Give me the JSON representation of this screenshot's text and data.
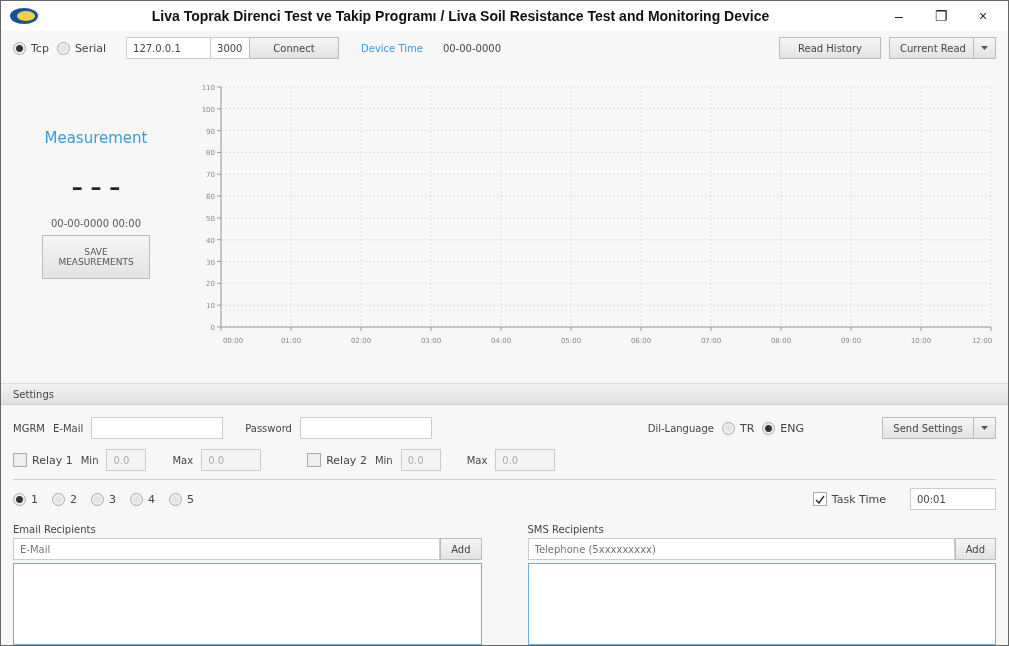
{
  "window": {
    "title": "Liva Toprak Direnci Test ve Takip Programı / Liva Soil Resistance Test and Monitoring Device",
    "controls": [
      "–",
      "❐",
      "×"
    ]
  },
  "connection": {
    "modes": [
      {
        "label": "Tcp",
        "selected": true
      },
      {
        "label": "Serial",
        "selected": false
      }
    ],
    "address": "127.0.0.1",
    "port": "3000",
    "connect": "Connect",
    "device_time_label": "Device Time",
    "device_time": "00-00-0000",
    "read_history": "Read History",
    "current_read": "Current Read"
  },
  "measurement": {
    "title": "Measurement",
    "value": "– – –",
    "timestamp": "00-00-0000 00:00",
    "save": "SAVE MEASUREMENTS"
  },
  "chart": {
    "chart_data": {
      "type": "line",
      "x": [
        "00:00",
        "01:00",
        "02:00",
        "03:00",
        "04:00",
        "05:00",
        "06:00",
        "07:00",
        "08:00",
        "09:00",
        "10:00",
        "12:00"
      ],
      "grid": true,
      "ylim": [
        0,
        110
      ],
      "yticks": [
        0,
        10,
        20,
        30,
        40,
        50,
        60,
        70,
        80,
        90,
        100,
        110
      ]
    }
  },
  "settings": {
    "title": "Settings",
    "mgrm_label": "MGRM",
    "email_label": "E-Mail",
    "password_label": "Password",
    "language_label": "Dil-Language",
    "languages": [
      {
        "label": "TR",
        "selected": false
      },
      {
        "label": "ENG",
        "selected": true
      }
    ],
    "send": "Send Settings",
    "relays": [
      {
        "label": "Relay 1",
        "checked": false,
        "min_label": "Min",
        "min": "0.0",
        "max_label": "Max",
        "max": "0.0"
      },
      {
        "label": "Relay 2",
        "checked": false,
        "min_label": "Min",
        "min": "0.0",
        "max_label": "Max",
        "max": "0.0"
      }
    ],
    "slots": [
      {
        "label": "1",
        "selected": true
      },
      {
        "label": "2",
        "selected": false
      },
      {
        "label": "3",
        "selected": false
      },
      {
        "label": "4",
        "selected": false
      },
      {
        "label": "5",
        "selected": false
      }
    ],
    "task_time": {
      "label": "Task Time",
      "checked": true,
      "value": "00:01"
    },
    "email_recipients": {
      "title": "Email Recipients",
      "placeholder": "E-Mail",
      "add": "Add"
    },
    "sms_recipients": {
      "title": "SMS Recipients",
      "placeholder": "Telephone (5xxxxxxxxx)",
      "add": "Add"
    }
  }
}
